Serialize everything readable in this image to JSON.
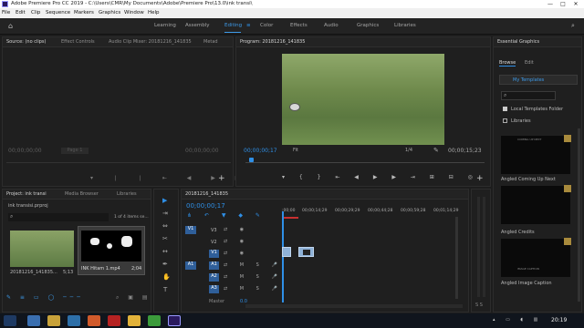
{
  "window": {
    "title": "Adobe Premiere Pro CC 2019 - C:\\Users\\CMR\\My Documents\\Adobe\\Premiere Pro\\13.0\\ink transi\\",
    "minimize": "—",
    "maximize": "□",
    "close": "✕"
  },
  "menu": [
    "File",
    "Edit",
    "Clip",
    "Sequence",
    "Markers",
    "Graphics",
    "Window",
    "Help"
  ],
  "workspaces": [
    "Learning",
    "Assembly",
    "Editing",
    "Color",
    "Effects",
    "Audio",
    "Graphics",
    "Libraries"
  ],
  "active_workspace": "Editing",
  "source": {
    "tabs": [
      "Source: (no clips)",
      "Effect Controls",
      "Audio Clip Mixer: 20181216_141835",
      "Metad"
    ],
    "timecode_left": "00;00;00;00",
    "page": "Page 1",
    "timecode_right": "00;00;00;00"
  },
  "program": {
    "title": "Program: 20181216_141835",
    "timecode": "00;00;00;17",
    "fit": "Fit",
    "fraction": "1/4",
    "duration": "00;00;15;23"
  },
  "essential_graphics": {
    "title": "Essential Graphics",
    "tabs": [
      "Browse",
      "Edit"
    ],
    "dropdown": "My Templates",
    "local_folder": "Local Templates Folder",
    "libraries": "Libraries",
    "templates": [
      {
        "name": "Angled Coming Up Next",
        "thumb_text": "COMING UP NEXT"
      },
      {
        "name": "Angled Credits",
        "thumb_text": ""
      },
      {
        "name": "Angled Image Caption",
        "thumb_text": "IMAGE CAPTION"
      }
    ]
  },
  "project": {
    "tabs": [
      "Project: ink transi",
      "Media Browser",
      "Libraries"
    ],
    "file": "ink transisi.prproj",
    "count": "1 of 4 items se...",
    "items": [
      {
        "name": "20181216_141835...",
        "duration": "5;13"
      },
      {
        "name": "INK Hitam 1.mp4",
        "duration": "2;04"
      }
    ]
  },
  "timeline": {
    "tab": "20181216_141835",
    "timecode": "00;00;00;17",
    "ruler": [
      ";00;00",
      "00;00;14;29",
      "00;00;29;29",
      "00;00;44;28",
      "00;00;59;28",
      "00;01;14;29"
    ],
    "video_tracks": [
      "V3",
      "V2",
      "V1"
    ],
    "audio_tracks": [
      "A1",
      "A2",
      "A3"
    ],
    "source_v": "V1",
    "source_a": "A1",
    "master": "Master",
    "master_val": "0.0"
  },
  "taskbar": {
    "time": "20:19"
  },
  "colors": {
    "accent": "#2f8fe6",
    "clip_video": "#8fb2d8",
    "clip_audio": "#5fae6b"
  }
}
